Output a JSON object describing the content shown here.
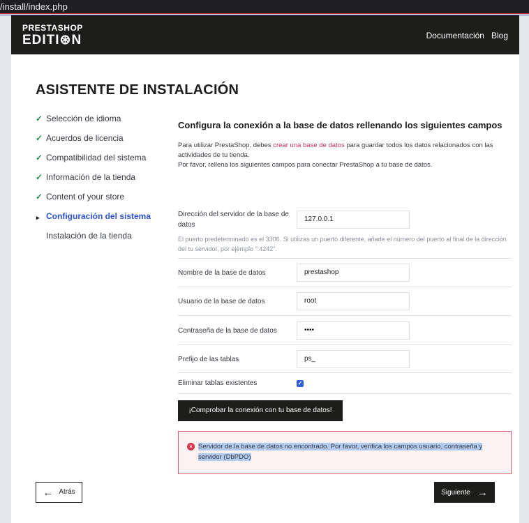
{
  "browser": {
    "url": "/install/index.php"
  },
  "header": {
    "logo_line1": "PRESTASHOP",
    "logo_line2": "EDITI⊛N",
    "nav": [
      "Documentación",
      "Blog"
    ]
  },
  "page_title": "ASISTENTE DE INSTALACIÓN",
  "steps": [
    {
      "label": "Selección de idioma",
      "state": "done"
    },
    {
      "label": "Acuerdos de licencia",
      "state": "done"
    },
    {
      "label": "Compatibilidad del sistema",
      "state": "done"
    },
    {
      "label": "Información de la tienda",
      "state": "done"
    },
    {
      "label": "Content of your store",
      "state": "done"
    },
    {
      "label": "Configuración del sistema",
      "state": "current"
    },
    {
      "label": "Instalación de la tienda",
      "state": "pending"
    }
  ],
  "content": {
    "heading": "Configura la conexión a la base de datos rellenando los siguientes campos",
    "intro_before": "Para utilizar PrestaShop, debes ",
    "intro_link": "crear una base de datos",
    "intro_after": " para guardar todos los datos relacionados con las actividades de tu tienda.",
    "intro_line2": "Por favor, rellena los siguientes campos para conectar PrestaShop a tu base de datos."
  },
  "form": {
    "server": {
      "label": "Dirección del servidor de la base de datos",
      "value": "127.0.0.1"
    },
    "server_hint": "El puerto predeterminado es el 3306. Si utilizas un puerto diferente, añade el número del puerto al final de la dirección del tu servidor, por ejemplo \":4242\".",
    "db_name": {
      "label": "Nombre de la base de datos",
      "value": "prestashop"
    },
    "db_user": {
      "label": "Usuario de la base de datos",
      "value": "root"
    },
    "db_password": {
      "label": "Contraseña de la base de datos",
      "value": "••••"
    },
    "prefix": {
      "label": "Prefijo de las tablas",
      "value": "ps_"
    },
    "drop_tables": {
      "label": "Eliminar tablas existentes",
      "checked": true
    },
    "test_button": "¡Comprobar la conexión con tu base de datos!"
  },
  "alert": {
    "message": "Servidor de la base de datos no encontrado. Por favor, verifica los campos usuario, contraseña y servidor (DbPDO)"
  },
  "footer": {
    "back_label": "Atrás",
    "next_label": "Siguiente"
  },
  "colors": {
    "brand_dark": "#1d1d1b",
    "check_green": "#2a8a4d",
    "current_step_blue": "#2e52d6",
    "link_pink": "#c8305c",
    "error_red": "#d3344a"
  }
}
